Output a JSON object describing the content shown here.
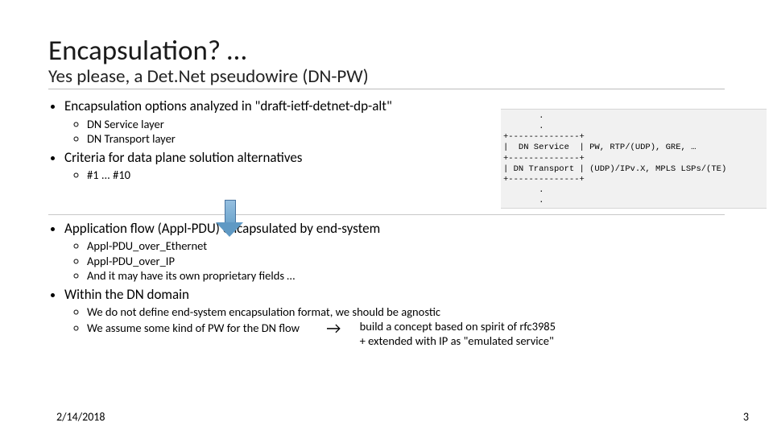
{
  "title": "Encapsulation? …",
  "subtitle": "Yes please, a Det.Net pseudowire (DN-PW)",
  "b1": "Encapsulation options analyzed in \"draft-ietf-detnet-dp-alt\"",
  "b1a": "DN Service layer",
  "b1b": "DN Transport layer",
  "b2": "Criteria for data plane solution alternatives",
  "b2a": "#1 ... #10",
  "b3": "Application flow (Appl-PDU) encapsulated by end-system",
  "b3a": "Appl-PDU_over_Ethernet",
  "b3b": "Appl-PDU_over_IP",
  "b3c": "And it may have its own proprietary fields …",
  "b4": "Within the DN domain",
  "b4a": "We do not define end-system encapsulation format, we should be agnostic",
  "b4b_pre": "We assume some kind of PW for the DN flow",
  "b4b_post1": "build a concept based on spirit of rfc3985",
  "b4b_post2": "+ extended with IP as \"emulated service\"",
  "code": "       .\n       .\n+--------------+\n|  DN Service  | PW, RTP/(UDP), GRE, …\n+--------------+\n| DN Transport | (UDP)/IPv.X, MPLS LSPs/(TE)\n+--------------+\n       .\n       .",
  "footer_date": "2/14/2018",
  "footer_num": "3"
}
